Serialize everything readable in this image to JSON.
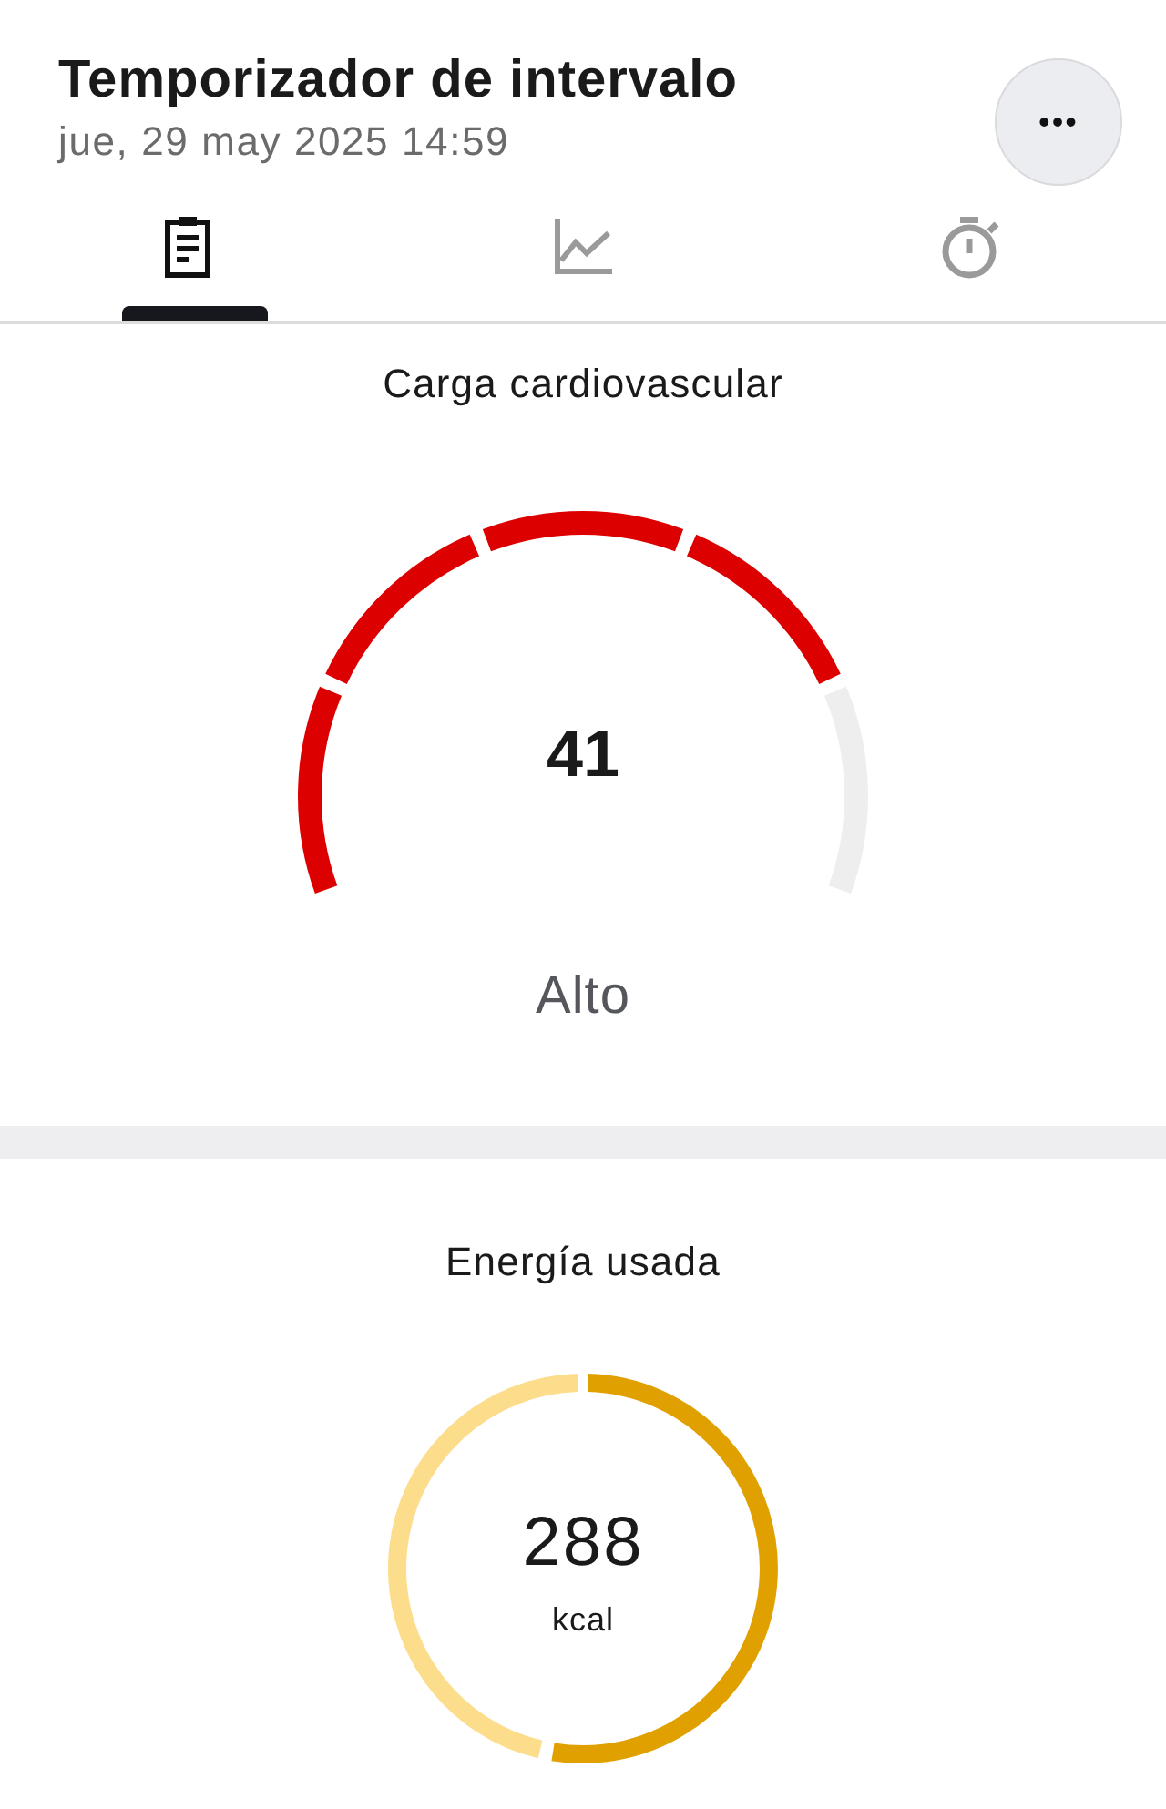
{
  "header": {
    "title": "Temporizador de intervalo",
    "subtitle": "jue, 29 may 2025 14:59",
    "more_button": "•••"
  },
  "tabs": [
    {
      "kind": "summary",
      "selected": true
    },
    {
      "kind": "chart",
      "selected": false
    },
    {
      "kind": "timer",
      "selected": false
    }
  ],
  "cardio_load": {
    "title": "Carga cardiovascular",
    "value": "41",
    "rating": "Alto"
  },
  "energy": {
    "title": "Energía usada",
    "value": "288",
    "unit": "kcal"
  }
}
